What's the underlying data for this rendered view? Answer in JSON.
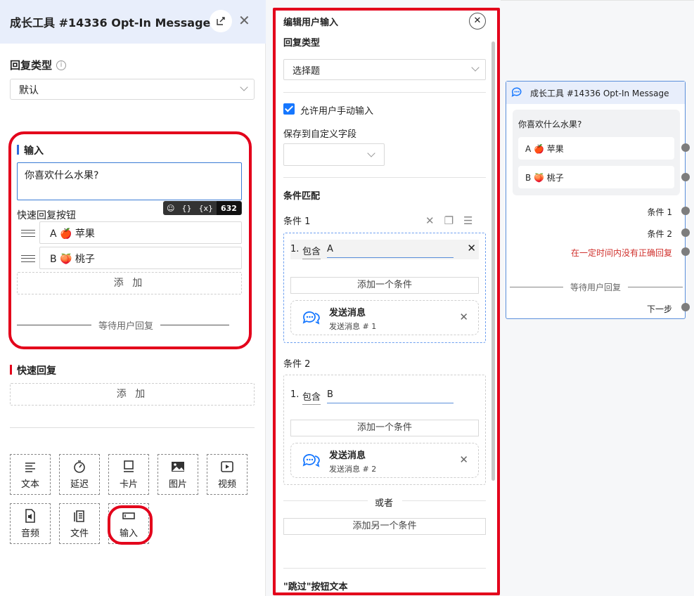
{
  "left_panel": {
    "title": "成长工具 #14336 Opt-In Message",
    "reply_type_label": "回复类型",
    "reply_type_value": "默认",
    "input_section_label": "输入",
    "input_text": "你喜欢什么水果?",
    "toolbar": {
      "emoji": "☺",
      "braces": "{}",
      "var": "{x}",
      "count": "632"
    },
    "quick_reply_buttons_label": "快速回复按钮",
    "quick_replies": [
      {
        "label": "A 🍎 苹果"
      },
      {
        "label": "B 🍑 桃子"
      }
    ],
    "add_label": "添 加",
    "wait_reply_label": "等待用户回复",
    "quick_reply_section_label": "快速回复",
    "add_label_2": "添 加",
    "tools": [
      {
        "label": "文本",
        "icon": "text-icon"
      },
      {
        "label": "延迟",
        "icon": "timer-icon"
      },
      {
        "label": "卡片",
        "icon": "card-icon"
      },
      {
        "label": "图片",
        "icon": "image-icon"
      },
      {
        "label": "视频",
        "icon": "video-icon"
      },
      {
        "label": "音频",
        "icon": "audio-icon"
      },
      {
        "label": "文件",
        "icon": "file-icon"
      },
      {
        "label": "输入",
        "icon": "input-icon"
      }
    ]
  },
  "middle_panel": {
    "title": "编辑用户输入",
    "reply_type_label": "回复类型",
    "reply_type_value": "选择题",
    "allow_manual_input_label": "允许用户手动输入",
    "allow_manual_input_checked": true,
    "save_custom_field_label": "保存到自定义字段",
    "condition_match_label": "条件匹配",
    "conditions": [
      {
        "title": "条件 1",
        "num": "1.",
        "keyword": "包含",
        "value": "A",
        "add_condition": "添加一个条件",
        "action_title": "发送消息",
        "action_sub": "发送消息 # 1"
      },
      {
        "title": "条件 2",
        "num": "1.",
        "keyword": "包含",
        "value": "B",
        "add_condition": "添加一个条件",
        "action_title": "发送消息",
        "action_sub": "发送消息 # 2"
      }
    ],
    "or_label": "或者",
    "add_another_condition": "添加另一个条件",
    "skip_button_text_label": "\"跳过\"按钮文本"
  },
  "node": {
    "title": "成长工具 #14336 Opt-In Message",
    "question": "你喜欢什么水果?",
    "options": [
      "A 🍎 苹果",
      "B 🍑 桃子"
    ],
    "condition1": "条件 1",
    "condition2": "条件 2",
    "timeout_label": "在一定时间内没有正确回复",
    "wait_label": "等待用户回复",
    "next_step": "下一步"
  },
  "colors": {
    "accent_blue": "#1677ff",
    "highlight_red": "#e3001b",
    "timeout_red": "#d0312d"
  }
}
